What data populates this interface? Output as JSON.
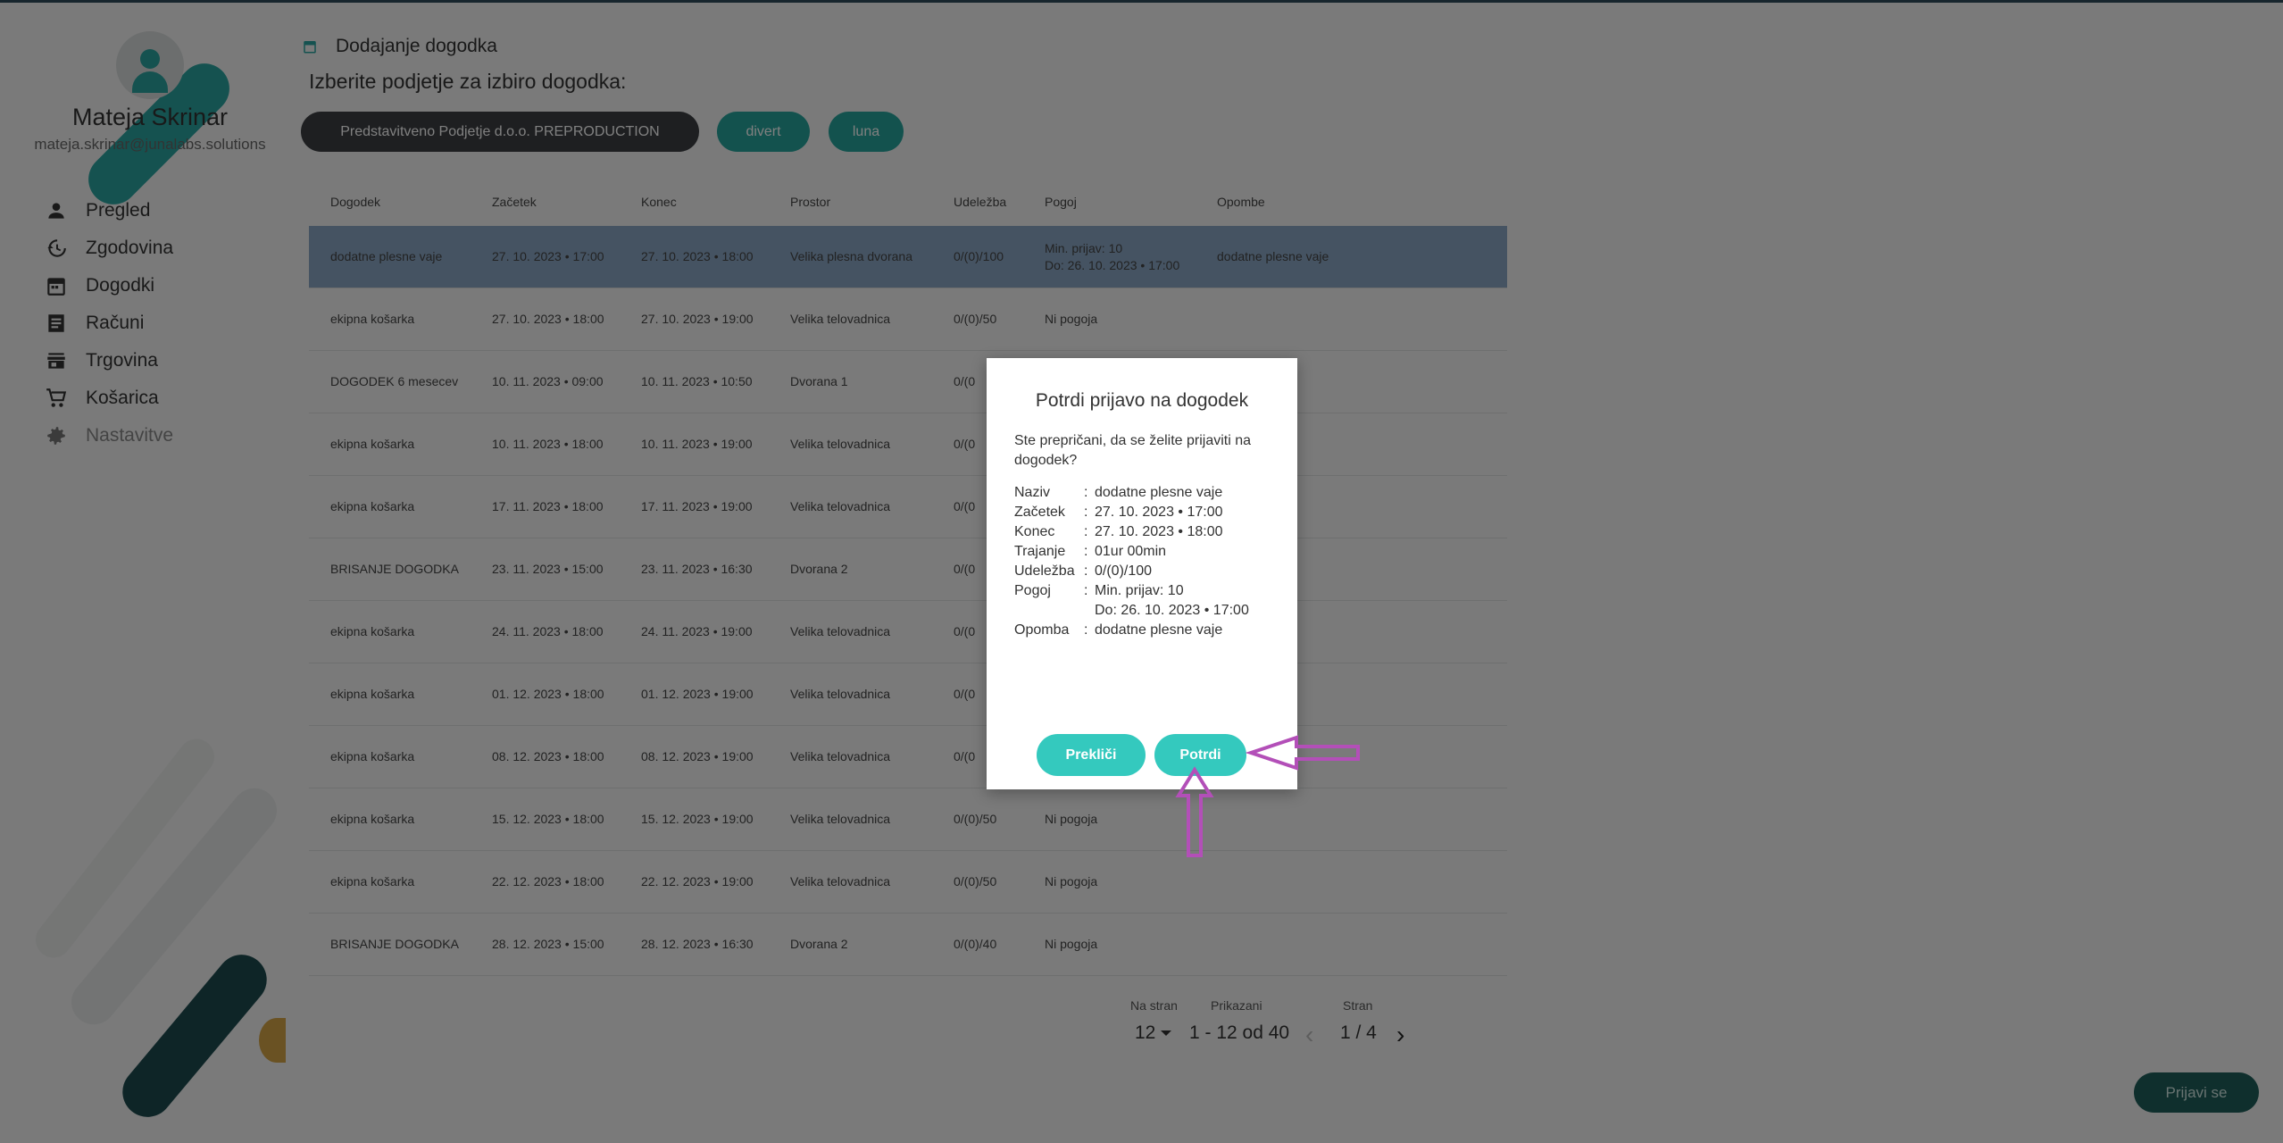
{
  "user": {
    "name": "Mateja Skrinar",
    "email": "mateja.skrinar@junalabs.solutions"
  },
  "nav": [
    {
      "label": "Pregled",
      "icon": "person-icon"
    },
    {
      "label": "Zgodovina",
      "icon": "history-icon"
    },
    {
      "label": "Dogodki",
      "icon": "calendar-icon"
    },
    {
      "label": "Računi",
      "icon": "receipt-icon"
    },
    {
      "label": "Trgovina",
      "icon": "store-icon"
    },
    {
      "label": "Košarica",
      "icon": "cart-icon"
    },
    {
      "label": "Nastavitve",
      "icon": "gear-icon"
    }
  ],
  "header": {
    "title": "Dodajanje dogodka",
    "subtitle": "Izberite podjetje za izbiro dogodka:"
  },
  "companies": [
    "Predstavitveno Podjetje d.o.o. PREPRODUCTION",
    "divert",
    "luna"
  ],
  "table": {
    "columns": [
      "Dogodek",
      "Začetek",
      "Konec",
      "Prostor",
      "Udeležba",
      "Pogoj",
      "Opombe"
    ],
    "rows": [
      {
        "event": "dodatne plesne vaje",
        "start": "27. 10. 2023 • 17:00",
        "end": "27. 10. 2023 • 18:00",
        "place": "Velika plesna dvorana",
        "attendance": "0/(0)/100",
        "cond1": "Min. prijav: 10",
        "cond2": "Do: 26. 10. 2023 • 17:00",
        "note": "dodatne plesne vaje"
      },
      {
        "event": "ekipna košarka",
        "start": "27. 10. 2023 • 18:00",
        "end": "27. 10. 2023 • 19:00",
        "place": "Velika telovadnica",
        "attendance": "0/(0)/50",
        "cond1": "Ni pogoja",
        "cond2": "",
        "note": ""
      },
      {
        "event": "DOGODEK 6 mesecev",
        "start": "10. 11. 2023 • 09:00",
        "end": "10. 11. 2023 • 10:50",
        "place": "Dvorana 1",
        "attendance": "0/(0",
        "cond1": "",
        "cond2": "",
        "note": ""
      },
      {
        "event": "ekipna košarka",
        "start": "10. 11. 2023 • 18:00",
        "end": "10. 11. 2023 • 19:00",
        "place": "Velika telovadnica",
        "attendance": "0/(0",
        "cond1": "",
        "cond2": "",
        "note": ""
      },
      {
        "event": "ekipna košarka",
        "start": "17. 11. 2023 • 18:00",
        "end": "17. 11. 2023 • 19:00",
        "place": "Velika telovadnica",
        "attendance": "0/(0",
        "cond1": "",
        "cond2": "",
        "note": ""
      },
      {
        "event": "BRISANJE DOGODKA",
        "start": "23. 11. 2023 • 15:00",
        "end": "23. 11. 2023 • 16:30",
        "place": "Dvorana 2",
        "attendance": "0/(0",
        "cond1": "",
        "cond2": "",
        "note": ""
      },
      {
        "event": "ekipna košarka",
        "start": "24. 11. 2023 • 18:00",
        "end": "24. 11. 2023 • 19:00",
        "place": "Velika telovadnica",
        "attendance": "0/(0",
        "cond1": "",
        "cond2": "",
        "note": ""
      },
      {
        "event": "ekipna košarka",
        "start": "01. 12. 2023 • 18:00",
        "end": "01. 12. 2023 • 19:00",
        "place": "Velika telovadnica",
        "attendance": "0/(0",
        "cond1": "",
        "cond2": "",
        "note": ""
      },
      {
        "event": "ekipna košarka",
        "start": "08. 12. 2023 • 18:00",
        "end": "08. 12. 2023 • 19:00",
        "place": "Velika telovadnica",
        "attendance": "0/(0",
        "cond1": "",
        "cond2": "",
        "note": ""
      },
      {
        "event": "ekipna košarka",
        "start": "15. 12. 2023 • 18:00",
        "end": "15. 12. 2023 • 19:00",
        "place": "Velika telovadnica",
        "attendance": "0/(0)/50",
        "cond1": "Ni pogoja",
        "cond2": "",
        "note": ""
      },
      {
        "event": "ekipna košarka",
        "start": "22. 12. 2023 • 18:00",
        "end": "22. 12. 2023 • 19:00",
        "place": "Velika telovadnica",
        "attendance": "0/(0)/50",
        "cond1": "Ni pogoja",
        "cond2": "",
        "note": ""
      },
      {
        "event": "BRISANJE DOGODKA",
        "start": "28. 12. 2023 • 15:00",
        "end": "28. 12. 2023 • 16:30",
        "place": "Dvorana 2",
        "attendance": "0/(0)/40",
        "cond1": "Ni pogoja",
        "cond2": "",
        "note": ""
      }
    ]
  },
  "pagination": {
    "per_page_label": "Na stran",
    "per_page": "12",
    "shown_label": "Prikazani",
    "shown": "1 - 12 od 40",
    "page_label": "Stran",
    "page": "1 / 4"
  },
  "signin_label": "Prijavi se",
  "modal": {
    "title": "Potrdi prijavo na dogodek",
    "question": "Ste prepričani, da se želite prijaviti na dogodek?",
    "details": [
      {
        "k": "Naziv",
        "v": "dodatne plesne vaje"
      },
      {
        "k": "Začetek",
        "v": "27. 10. 2023 • 17:00"
      },
      {
        "k": "Konec",
        "v": "27. 10. 2023 • 18:00"
      },
      {
        "k": "Trajanje",
        "v": "01ur 00min"
      },
      {
        "k": "Udeležba",
        "v": "0/(0)/100"
      },
      {
        "k": "Pogoj",
        "v": "Min. prijav: 10"
      },
      {
        "k": "",
        "v": "Do: 26. 10. 2023 • 17:00"
      },
      {
        "k": "Opomba",
        "v": "dodatne plesne vaje"
      }
    ],
    "cancel_label": "Prekliči",
    "confirm_label": "Potrdi"
  },
  "colors": {
    "accent": "#34c9be",
    "selected_row": "#8aa7c5",
    "annotation_arrow": "#b34fb8"
  }
}
